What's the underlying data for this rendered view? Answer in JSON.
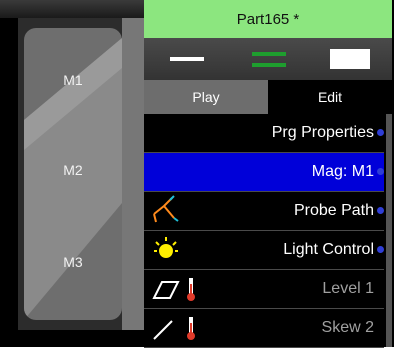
{
  "magnification_panel": {
    "levels": [
      "M1",
      "M2",
      "M3"
    ]
  },
  "program_panel": {
    "title": "Part165 *",
    "title_color": "#8ce67f",
    "toolbar_icons": [
      "minimize-bar-icon",
      "menu-lines-icon",
      "maximize-box-icon"
    ],
    "tabs": {
      "play": "Play",
      "edit": "Edit"
    },
    "items": [
      {
        "label": "Prg Properties",
        "icon": "",
        "selected": false,
        "dim": false
      },
      {
        "label": "Mag: M1",
        "icon": "",
        "selected": true,
        "dim": false
      },
      {
        "label": "Probe Path",
        "icon": "probe-path-icon",
        "selected": false,
        "dim": false
      },
      {
        "label": "Light Control",
        "icon": "light-bulb-icon",
        "selected": false,
        "dim": false
      },
      {
        "label": "Level 1",
        "icon": "plane-thermometer-icon",
        "selected": false,
        "dim": true
      },
      {
        "label": "Skew 2",
        "icon": "line-thermometer-icon",
        "selected": false,
        "dim": true
      }
    ],
    "selection_color": "#0000d9"
  }
}
